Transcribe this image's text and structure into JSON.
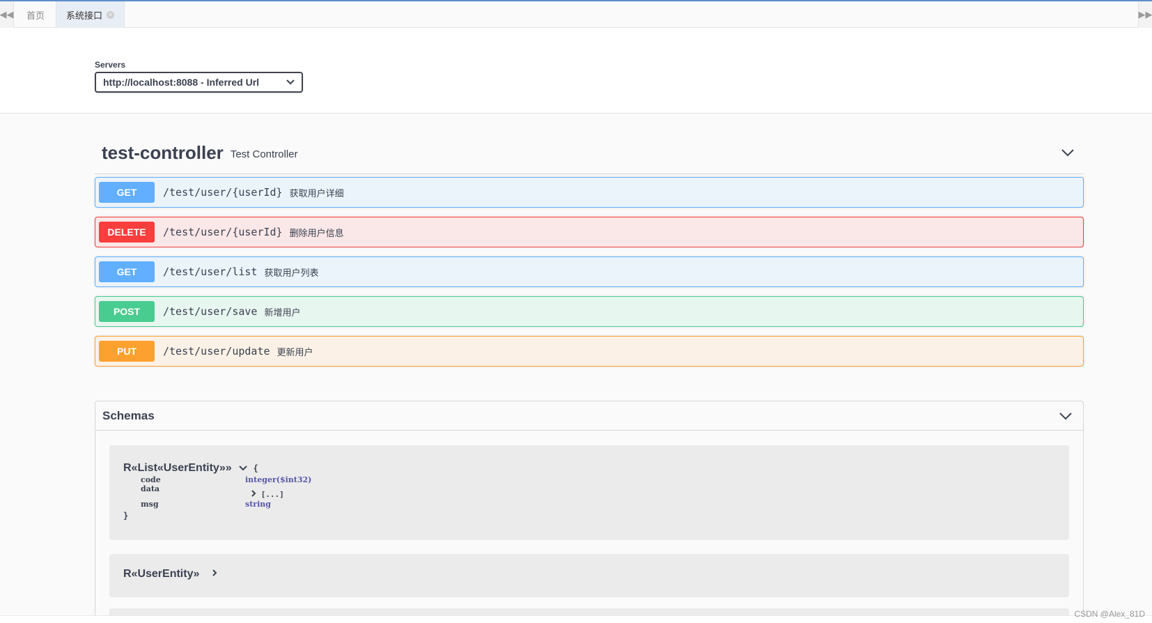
{
  "tabs": {
    "left_nav_icon": "double-chevron-left",
    "right_nav_icon": "double-chevron-right",
    "home_label": "首页",
    "active_label": "系统接口",
    "close_icon": "×"
  },
  "servers": {
    "label": "Servers",
    "selected": "http://localhost:8088 - Inferred Url",
    "chevron": "⌄"
  },
  "tag": {
    "name": "test-controller",
    "description": "Test Controller"
  },
  "operations": [
    {
      "method": "GET",
      "path": "/test/user/{userId}",
      "summary": "获取用户详细"
    },
    {
      "method": "DELETE",
      "path": "/test/user/{userId}",
      "summary": "删除用户信息"
    },
    {
      "method": "GET",
      "path": "/test/user/list",
      "summary": "获取用户列表"
    },
    {
      "method": "POST",
      "path": "/test/user/save",
      "summary": "新增用户"
    },
    {
      "method": "PUT",
      "path": "/test/user/update",
      "summary": "更新用户"
    }
  ],
  "schemas": {
    "title": "Schemas",
    "models": [
      {
        "name": "R«List«UserEntity»»",
        "open_brace": "{",
        "close_brace": "}",
        "properties": [
          {
            "name": "code",
            "type": "integer($int32)"
          },
          {
            "name": "data",
            "type": "[...]"
          },
          {
            "name": "msg",
            "type": "string"
          }
        ]
      },
      {
        "name": "R«UserEntity»"
      }
    ]
  },
  "watermark": "CSDN @Alex_81D",
  "colors": {
    "get": "#61affe",
    "delete": "#f93e3e",
    "post": "#49cc90",
    "put": "#fca130"
  }
}
